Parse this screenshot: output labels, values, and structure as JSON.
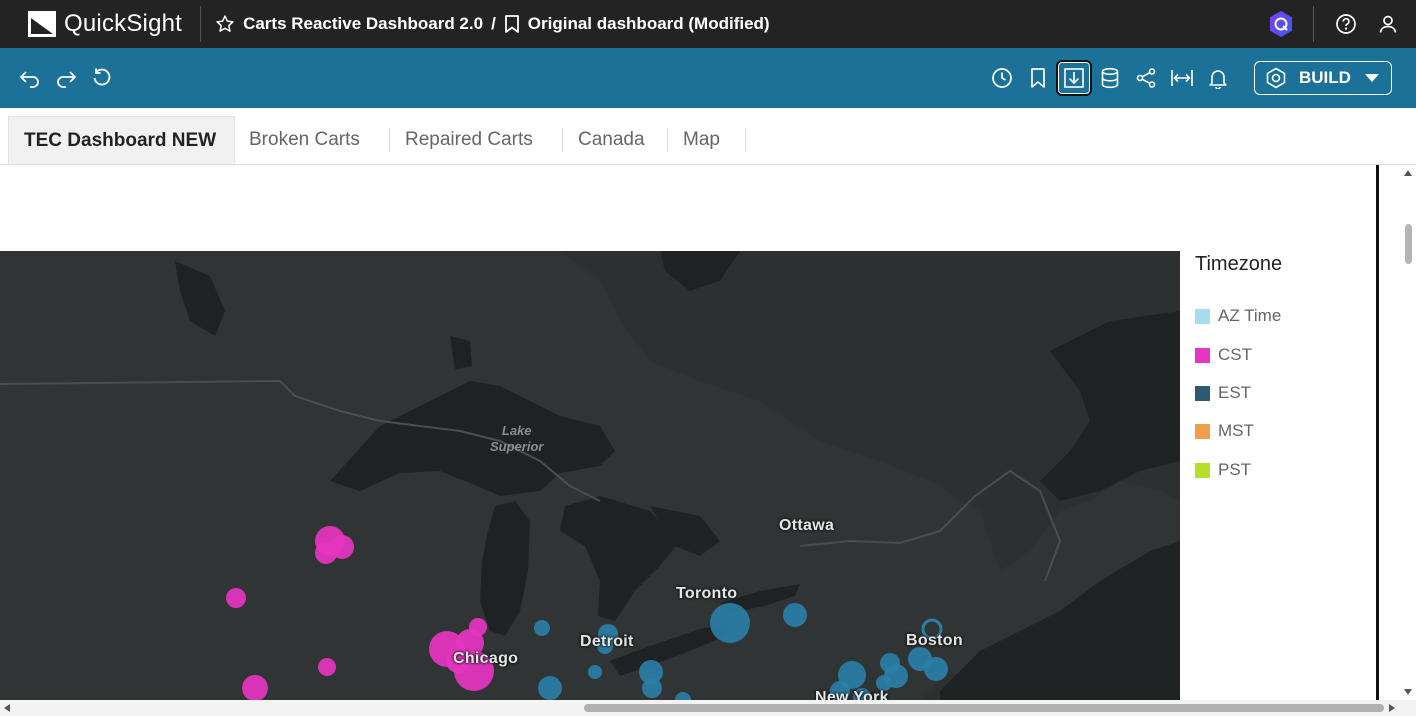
{
  "app": {
    "name": "QuickSight"
  },
  "breadcrumb": {
    "dashboard": "Carts Reactive Dashboard 2.0",
    "separator": "/",
    "sheet": "Original dashboard (Modified)"
  },
  "toolbar": {
    "build_label": "BUILD"
  },
  "tabs": [
    {
      "label": "TEC Dashboard NEW"
    },
    {
      "label": "Broken Carts"
    },
    {
      "label": "Repaired Carts"
    },
    {
      "label": "Canada"
    },
    {
      "label": "Map"
    }
  ],
  "map": {
    "cities": [
      "Ottawa",
      "Toronto",
      "Detroit",
      "Chicago",
      "Boston",
      "New York"
    ],
    "lake": [
      "Lake",
      "Superior"
    ]
  },
  "legend": {
    "title": "Timezone",
    "items": [
      {
        "label": "AZ Time",
        "color": "#a6dcef"
      },
      {
        "label": "CST",
        "color": "#e635c0"
      },
      {
        "label": "EST",
        "color": "#2c5a73"
      },
      {
        "label": "MST",
        "color": "#f0a04b"
      },
      {
        "label": "PST",
        "color": "#b6e025"
      }
    ]
  },
  "colors": {
    "topbar": "#232323",
    "toolbar": "#1c7199",
    "cst_point": "#e635c0",
    "est_point": "#2a7fa8"
  }
}
